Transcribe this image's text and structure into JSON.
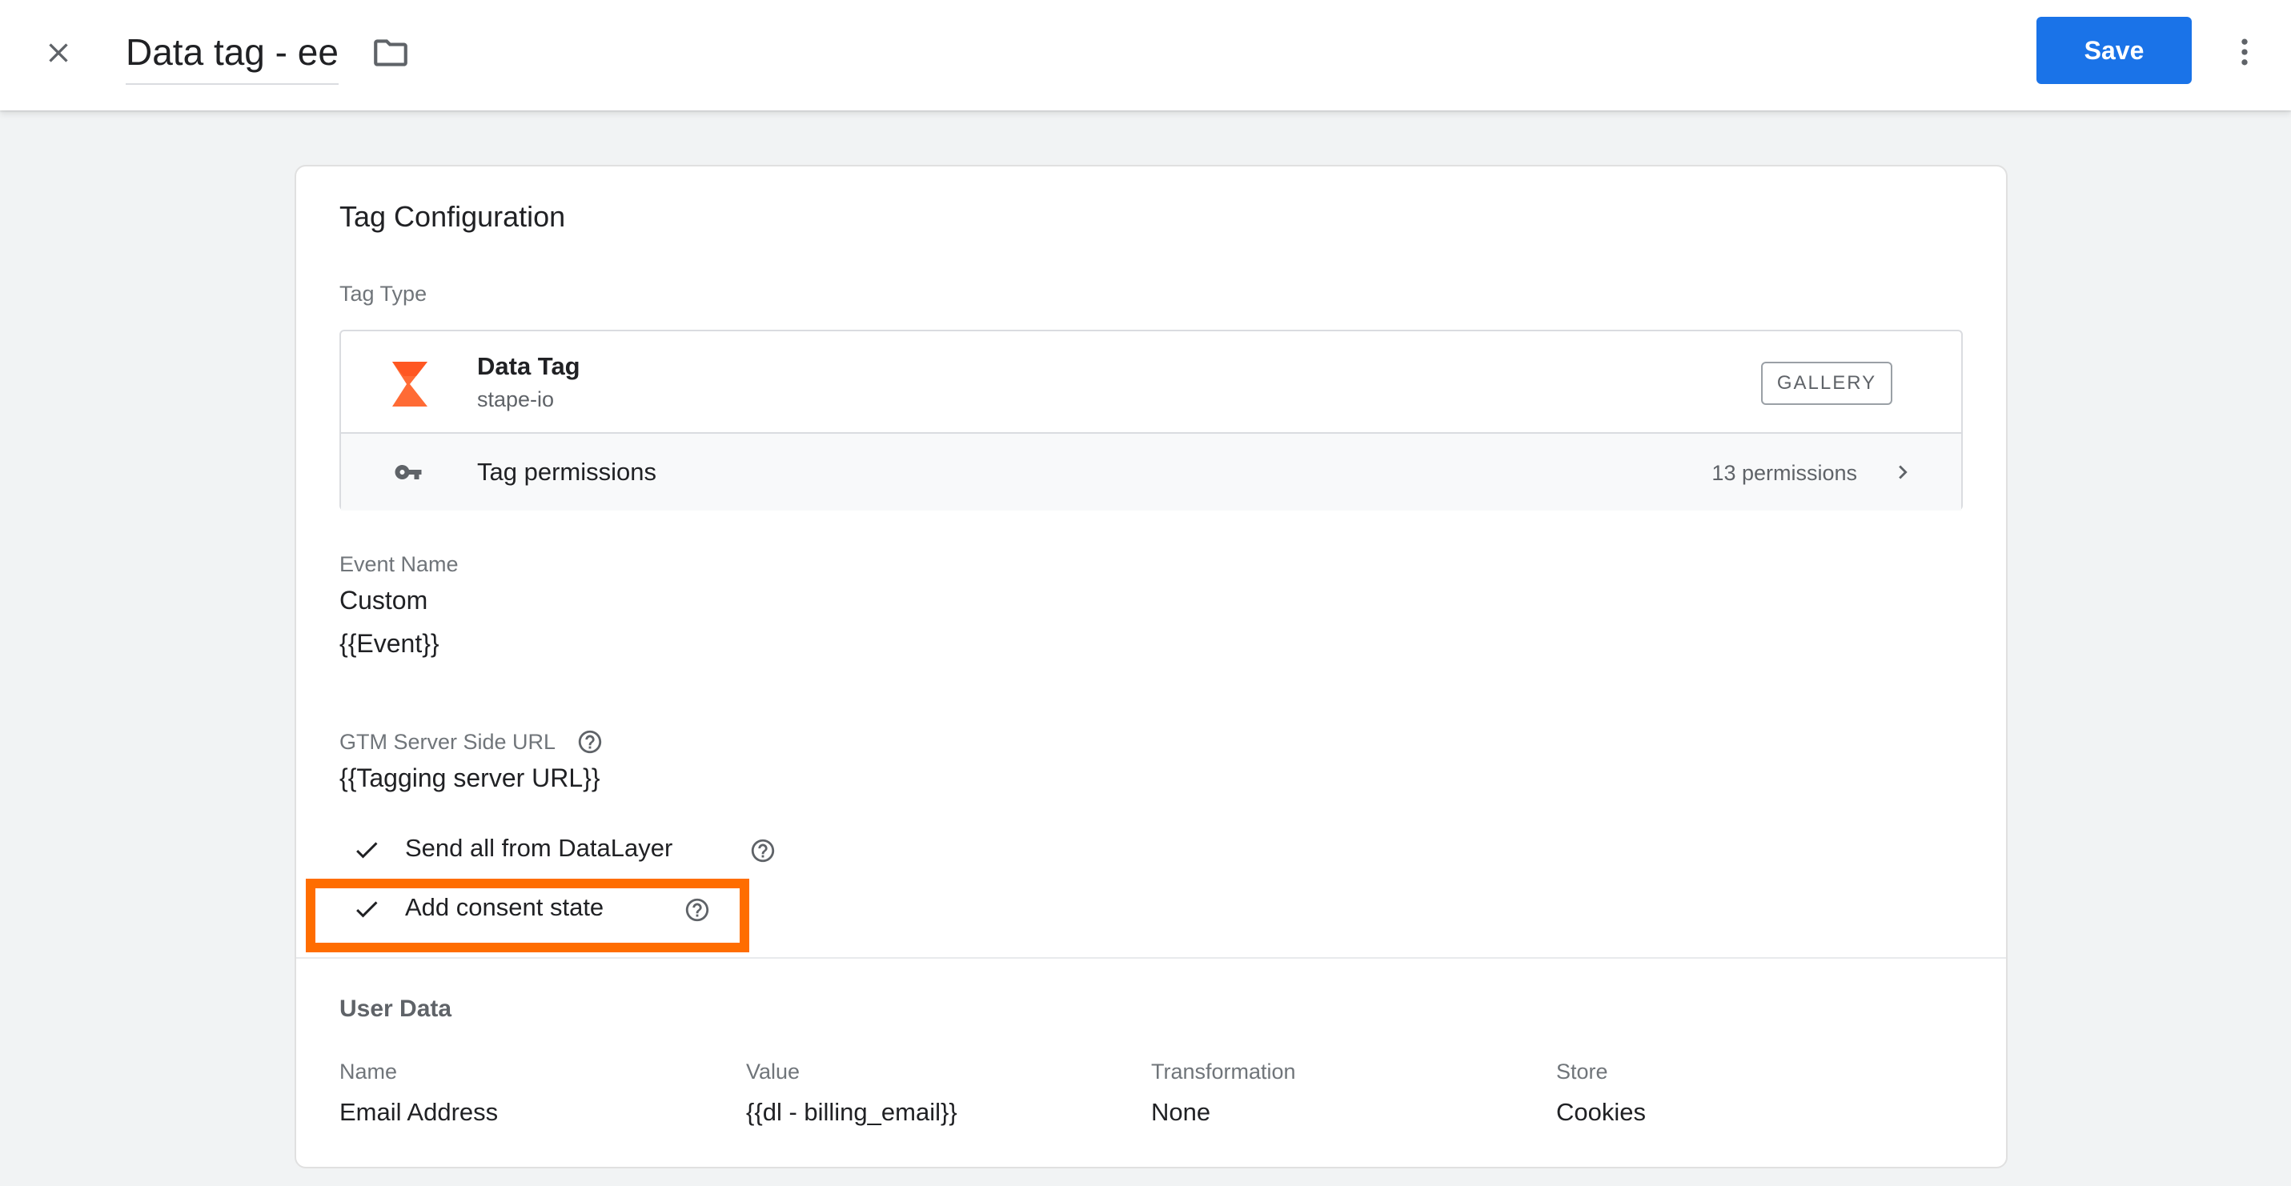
{
  "header": {
    "title": "Data tag - ee",
    "save_label": "Save"
  },
  "card": {
    "title": "Tag Configuration",
    "tag_type_label": "Tag Type",
    "tag": {
      "name": "Data Tag",
      "vendor": "stape-io",
      "gallery_label": "GALLERY",
      "logo_color": "#ff6b35"
    },
    "permissions": {
      "label": "Tag permissions",
      "count": "13 permissions"
    },
    "event_name": {
      "label": "Event Name",
      "type": "Custom",
      "value": "{{Event}}"
    },
    "server_url": {
      "label": "GTM Server Side URL",
      "value": "{{Tagging server URL}}"
    },
    "checks": [
      {
        "label": "Send all from DataLayer",
        "checked": true
      },
      {
        "label": "Add consent state",
        "checked": true,
        "highlighted": true
      }
    ],
    "user_data": {
      "title": "User Data",
      "columns": [
        "Name",
        "Value",
        "Transformation",
        "Store"
      ],
      "rows": [
        [
          "Email Address",
          "{{dl - billing_email}}",
          "None",
          "Cookies"
        ]
      ]
    }
  },
  "colors": {
    "primary": "#1a73e8",
    "highlight": "#ff6d00"
  }
}
